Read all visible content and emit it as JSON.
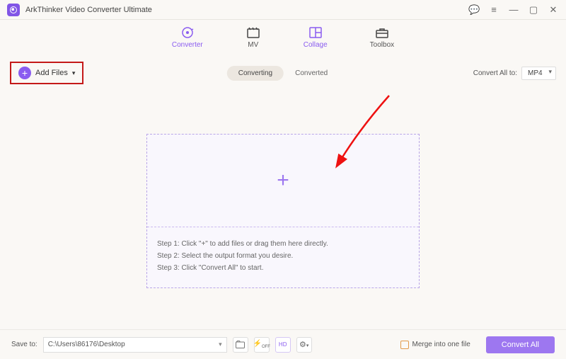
{
  "app": {
    "title": "ArkThinker Video Converter Ultimate"
  },
  "tabs": {
    "converter": "Converter",
    "mv": "MV",
    "collage": "Collage",
    "toolbox": "Toolbox"
  },
  "actions": {
    "addFiles": "Add Files",
    "converting": "Converting",
    "converted": "Converted",
    "convertAllTo": "Convert All to:",
    "format": "MP4"
  },
  "steps": {
    "s1": "Step 1: Click \"+\" to add files or drag them here directly.",
    "s2": "Step 2: Select the output format you desire.",
    "s3": "Step 3: Click \"Convert All\" to start."
  },
  "footer": {
    "saveTo": "Save to:",
    "path": "C:\\Users\\86176\\Desktop",
    "merge": "Merge into one file",
    "convertAll": "Convert All"
  }
}
